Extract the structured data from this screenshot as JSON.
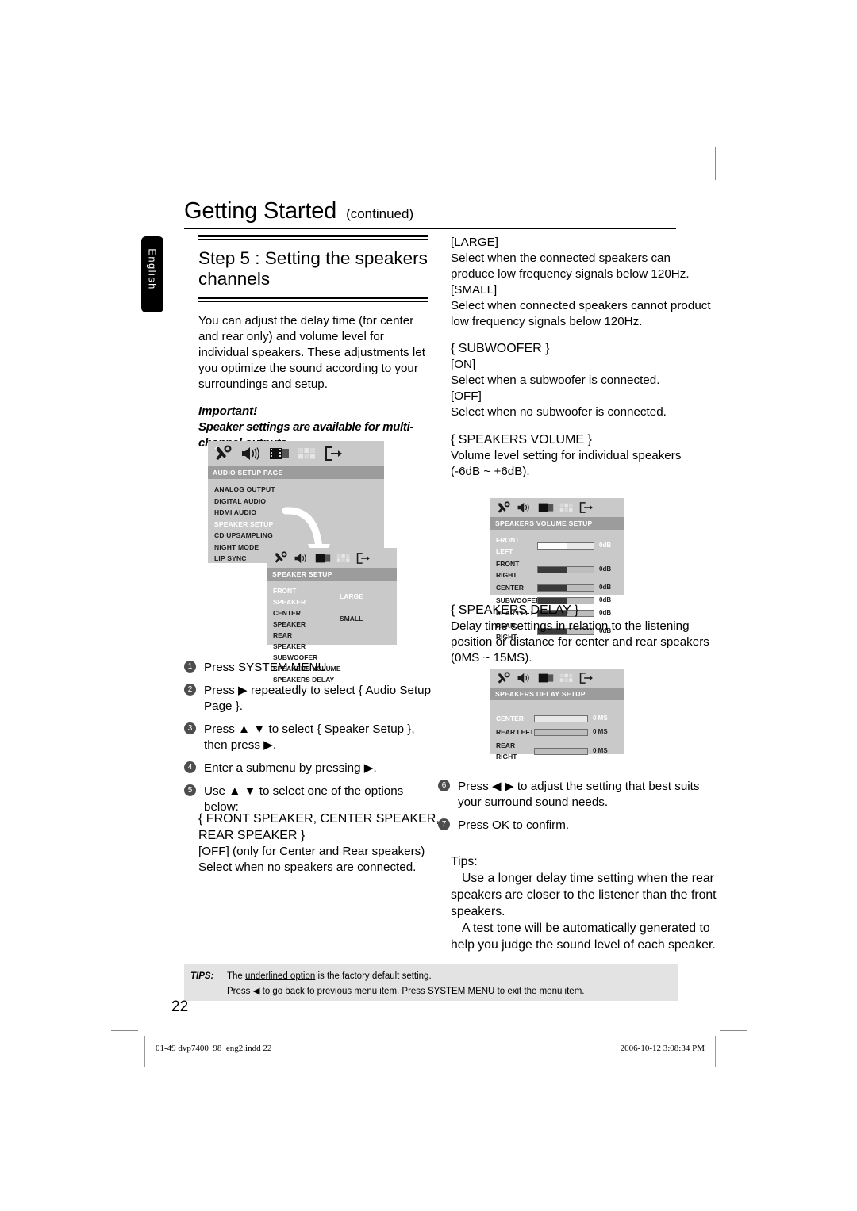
{
  "header": {
    "title": "Getting Started",
    "continued": "(continued)"
  },
  "language_tab": "English",
  "left_column": {
    "step_heading": "Step 5 : Setting the speakers channels",
    "intro": "You can adjust the delay time (for center and rear only) and volume level for individual speakers. These adjustments let you optimize the sound according to your surroundings and setup.",
    "important_label": "Important!",
    "important_text": "Speaker settings are available for multi-channel outputs.",
    "steps": [
      {
        "num": "1",
        "text": "Press SYSTEM MENU ."
      },
      {
        "num": "2",
        "text": "Press ▶ repeatedly to select { Audio Setup Page }."
      },
      {
        "num": "3",
        "text": "Press ▲ ▼ to select { Speaker Setup }, then press ▶."
      },
      {
        "num": "4",
        "text": "Enter a submenu by pressing ▶."
      },
      {
        "num": "5",
        "text": "Use ▲ ▼ to select one of the options below:"
      }
    ],
    "option_heading": "{ FRONT SPEAKER, CENTER SPEAKER, REAR SPEAKER }",
    "option_off_label": "[OFF] (only for Center and Rear speakers)",
    "option_off_desc": "Select when no speakers are connected."
  },
  "right_column": {
    "large_label": "[LARGE]",
    "large_desc": "Select when the connected speakers can produce low frequency signals below 120Hz.",
    "small_label": "[SMALL]",
    "small_desc": "Select when connected speakers cannot product low frequency signals below 120Hz.",
    "subwoofer_heading": "{ SUBWOOFER }",
    "subwoofer_on_label": "[ON]",
    "subwoofer_on_desc": "Select when a subwoofer is connected.",
    "subwoofer_off_label": "[OFF]",
    "subwoofer_off_desc": "Select when no subwoofer is connected.",
    "volume_heading": "{ SPEAKERS VOLUME }",
    "volume_desc": "Volume level setting for individual speakers (-6dB ~ +6dB).",
    "delay_heading": "{ SPEAKERS DELAY }",
    "delay_desc": "Delay time settings in relation to the listening position or distance for center and rear speakers (0MS ~ 15MS).",
    "steps": [
      {
        "num": "6",
        "text": "Press ◀ ▶ to adjust the setting that best suits your surround sound needs."
      },
      {
        "num": "7",
        "text": "Press OK  to confirm."
      }
    ],
    "tips_label": "Tips:",
    "tip_1": "Use a longer delay time setting when the rear speakers are closer to the listener than the front speakers.",
    "tip_2": "A test tone will be automatically generated to help you judge the sound level of each speaker."
  },
  "osd_audio_setup": {
    "title": "AUDIO SETUP PAGE",
    "icons": [
      "tools-icon",
      "speaker-icon",
      "video-icon",
      "grid-icon",
      "exit-icon"
    ],
    "items": [
      {
        "label": "ANALOG OUTPUT",
        "selected": false
      },
      {
        "label": "DIGITAL AUDIO",
        "selected": false
      },
      {
        "label": "HDMI AUDIO",
        "selected": false
      },
      {
        "label": "SPEAKER SETUP",
        "selected": true
      },
      {
        "label": "CD UPSAMPLING",
        "selected": false
      },
      {
        "label": "NIGHT MODE",
        "selected": false
      },
      {
        "label": "LIP SYNC",
        "selected": false
      }
    ]
  },
  "osd_speaker_setup": {
    "title": "SPEAKER SETUP",
    "icons": [
      "tools-icon",
      "speaker-icon",
      "video-icon",
      "grid-icon",
      "exit-icon"
    ],
    "items": [
      {
        "label": "FRONT SPEAKER",
        "value": "LARGE",
        "selected": true
      },
      {
        "label": "CENTER SPEAKER",
        "value": "SMALL",
        "selected": false
      },
      {
        "label": "REAR SPEAKER",
        "value": "",
        "selected": false
      },
      {
        "label": "SUBWOOFER",
        "value": "",
        "selected": false
      },
      {
        "label": "SPEAKERS VOLUME",
        "value": "",
        "selected": false
      },
      {
        "label": "SPEAKERS DELAY",
        "value": "",
        "selected": false
      }
    ]
  },
  "osd_speakers_volume": {
    "title": "SPEAKERS VOLUME SETUP",
    "icons": [
      "tools-icon",
      "speaker-icon",
      "video-icon",
      "grid-icon",
      "exit-icon"
    ],
    "rows": [
      {
        "label": "FRONT LEFT",
        "value": "0dB",
        "fill": 52,
        "selected": true
      },
      {
        "label": "FRONT RIGHT",
        "value": "0dB",
        "fill": 52,
        "selected": false
      },
      {
        "label": "CENTER",
        "value": "0dB",
        "fill": 52,
        "selected": false
      },
      {
        "label": "SUBWOOFER",
        "value": "0dB",
        "fill": 52,
        "selected": false
      },
      {
        "label": "REAR LEFT",
        "value": "0dB",
        "fill": 52,
        "selected": false
      },
      {
        "label": "REAR RIGHT",
        "value": "0dB",
        "fill": 52,
        "selected": false
      }
    ]
  },
  "osd_speakers_delay": {
    "title": "SPEAKERS DELAY SETUP",
    "icons": [
      "tools-icon",
      "speaker-icon",
      "video-icon",
      "grid-icon",
      "exit-icon"
    ],
    "rows": [
      {
        "label": "CENTER",
        "value": "0 MS",
        "fill": 0,
        "selected": true
      },
      {
        "label": "REAR LEFT",
        "value": "0 MS",
        "fill": 0,
        "selected": false
      },
      {
        "label": "REAR RIGHT",
        "value": "0 MS",
        "fill": 0,
        "selected": false
      }
    ]
  },
  "tips_box": {
    "label": "TIPS:",
    "line1_pre": "The ",
    "line1_underlined": "underlined option",
    "line1_post": " is the factory default setting.",
    "line2": "Press ◀ to go back to previous menu item. Press SYSTEM MENU  to exit the menu item."
  },
  "page_number": "22",
  "print_footer": {
    "file": "01-49 dvp7400_98_eng2.indd   22",
    "timestamp": "2006-10-12   3:08:34 PM"
  }
}
